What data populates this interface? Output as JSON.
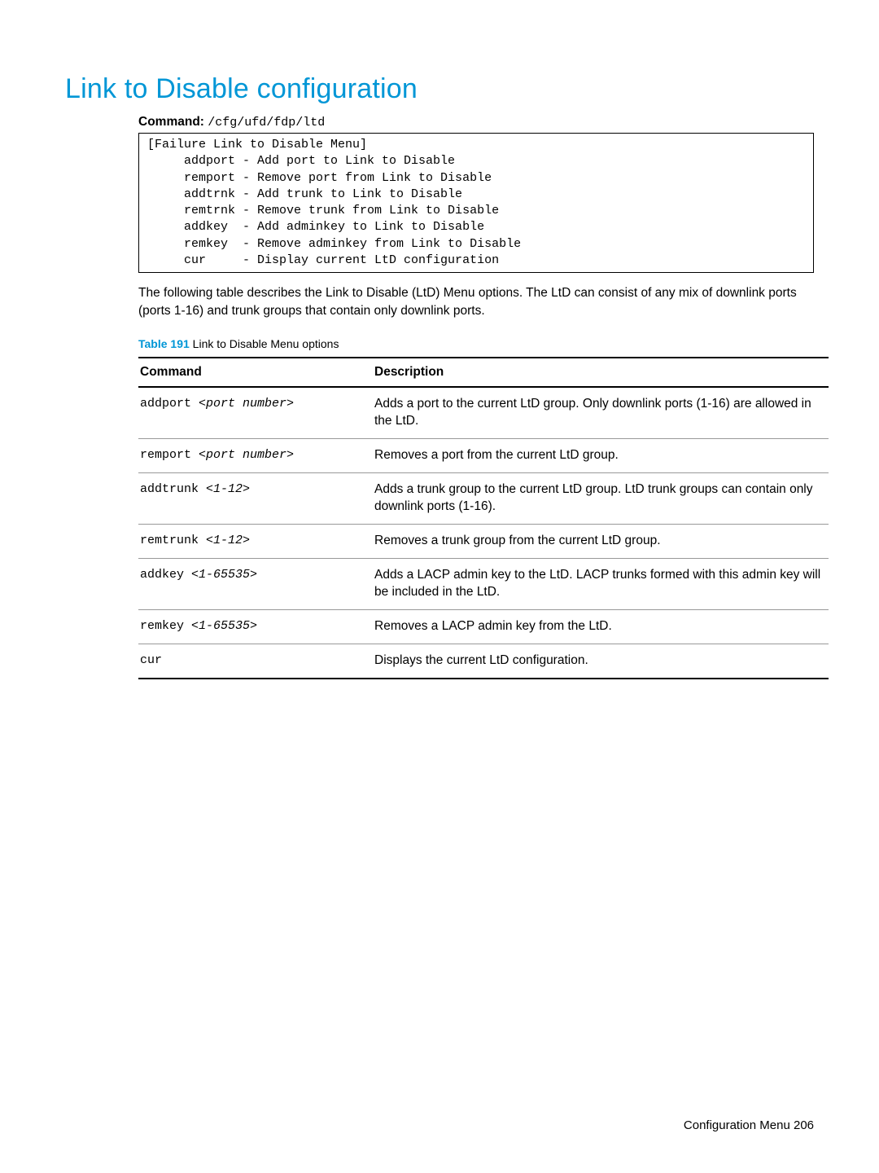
{
  "title": "Link to Disable configuration",
  "command_label": "Command:",
  "command_path": "/cfg/ufd/fdp/ltd",
  "terminal_text": "[Failure Link to Disable Menu]\n     addport - Add port to Link to Disable\n     remport - Remove port from Link to Disable\n     addtrnk - Add trunk to Link to Disable\n     remtrnk - Remove trunk from Link to Disable\n     addkey  - Add adminkey to Link to Disable\n     remkey  - Remove adminkey from Link to Disable\n     cur     - Display current LtD configuration",
  "body_paragraph": "The following table describes the Link to Disable (LtD) Menu options. The LtD can consist of any mix of downlink ports (ports 1-16) and trunk groups that contain only downlink ports.",
  "table_caption_label": "Table 191",
  "table_caption_text": "  Link to Disable Menu options",
  "columns": {
    "command": "Command",
    "description": "Description"
  },
  "rows": [
    {
      "cmd_base": "addport ",
      "cmd_arg": "<port number>",
      "desc": "Adds a port to the current LtD group. Only downlink ports (1-16) are allowed in the LtD."
    },
    {
      "cmd_base": "remport ",
      "cmd_arg": "<port number>",
      "desc": "Removes a port from the current LtD group."
    },
    {
      "cmd_base": "addtrunk ",
      "cmd_arg": "<1-12>",
      "desc": "Adds a trunk group to the current LtD group. LtD trunk groups can contain only downlink ports (1-16)."
    },
    {
      "cmd_base": "remtrunk ",
      "cmd_arg": "<1-12>",
      "desc": "Removes a trunk group from the current LtD group."
    },
    {
      "cmd_base": "addkey ",
      "cmd_arg": "<1-65535>",
      "desc": "Adds a LACP admin key to the LtD. LACP trunks formed with this admin key will be included in the LtD."
    },
    {
      "cmd_base": "remkey ",
      "cmd_arg": "<1-65535>",
      "desc": "Removes a LACP admin key from the LtD."
    },
    {
      "cmd_base": "cur",
      "cmd_arg": "",
      "desc": "Displays the current LtD configuration."
    }
  ],
  "footer": "Configuration Menu   206"
}
